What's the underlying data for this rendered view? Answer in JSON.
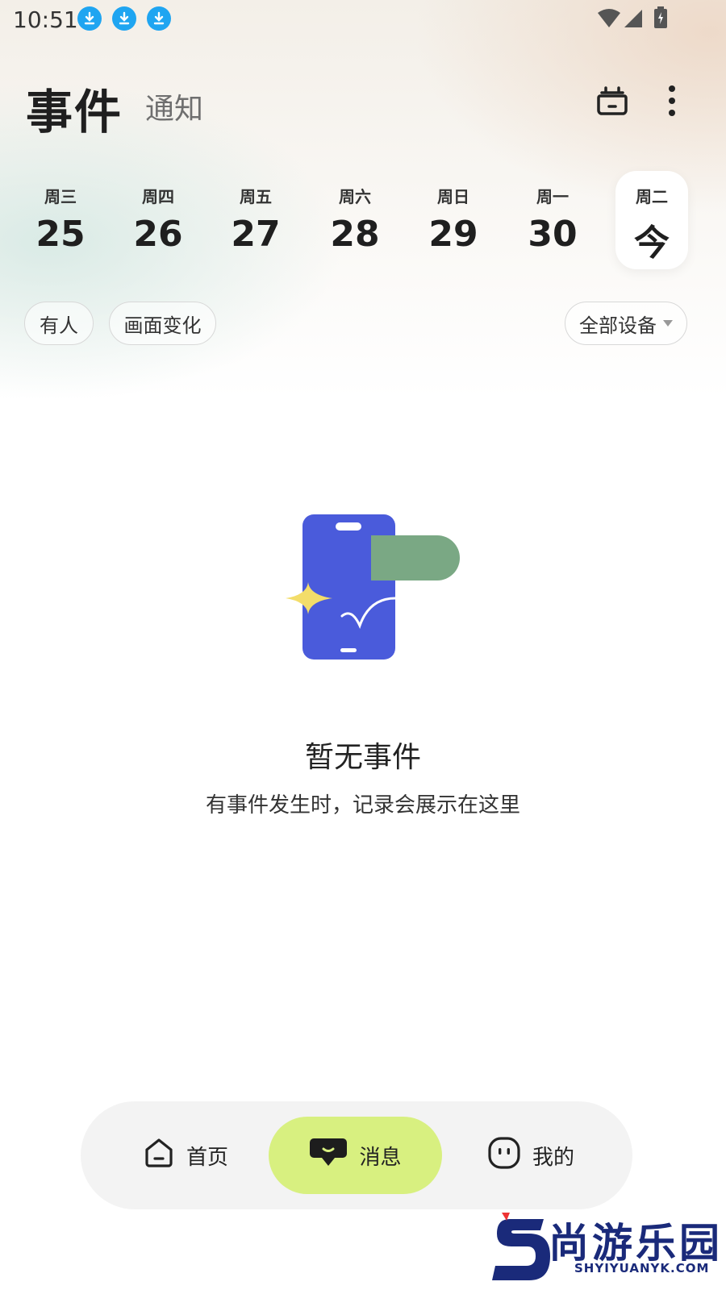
{
  "status_bar": {
    "time": "10:51",
    "download_icons": [
      "download-icon",
      "download-icon",
      "download-icon"
    ],
    "icons": [
      "wifi-icon",
      "signal-icon",
      "battery-charging-icon"
    ]
  },
  "header": {
    "title": "事件",
    "tab_notify": "通知",
    "camera_icon": "camera-icon",
    "more_icon": "more-vertical-icon"
  },
  "week": [
    {
      "weekday": "周三",
      "day": "25"
    },
    {
      "weekday": "周四",
      "day": "26"
    },
    {
      "weekday": "周五",
      "day": "27"
    },
    {
      "weekday": "周六",
      "day": "28"
    },
    {
      "weekday": "周日",
      "day": "29"
    },
    {
      "weekday": "周一",
      "day": "30"
    },
    {
      "weekday": "周二",
      "day": "今"
    }
  ],
  "filters": {
    "chips": [
      "有人",
      "画面变化"
    ],
    "device_select": "全部设备"
  },
  "empty_state": {
    "title": "暂无事件",
    "subtitle": "有事件发生时，记录会展示在这里"
  },
  "bottom_nav": {
    "items": [
      {
        "label": "首页",
        "icon": "home-icon",
        "active": false
      },
      {
        "label": "消息",
        "icon": "message-icon",
        "active": true
      },
      {
        "label": "我的",
        "icon": "profile-icon",
        "active": false
      }
    ],
    "active_color": "#d8f080"
  },
  "watermark": {
    "text": "尚游乐园",
    "url_text": "SHYIYUANYK.COM"
  },
  "colors": {
    "download_badge": "#1fa5f1",
    "phone_illustration": "#4a5bdb",
    "bubble_illustration": "#7aa884",
    "sparkle": "#f3dd6a"
  }
}
